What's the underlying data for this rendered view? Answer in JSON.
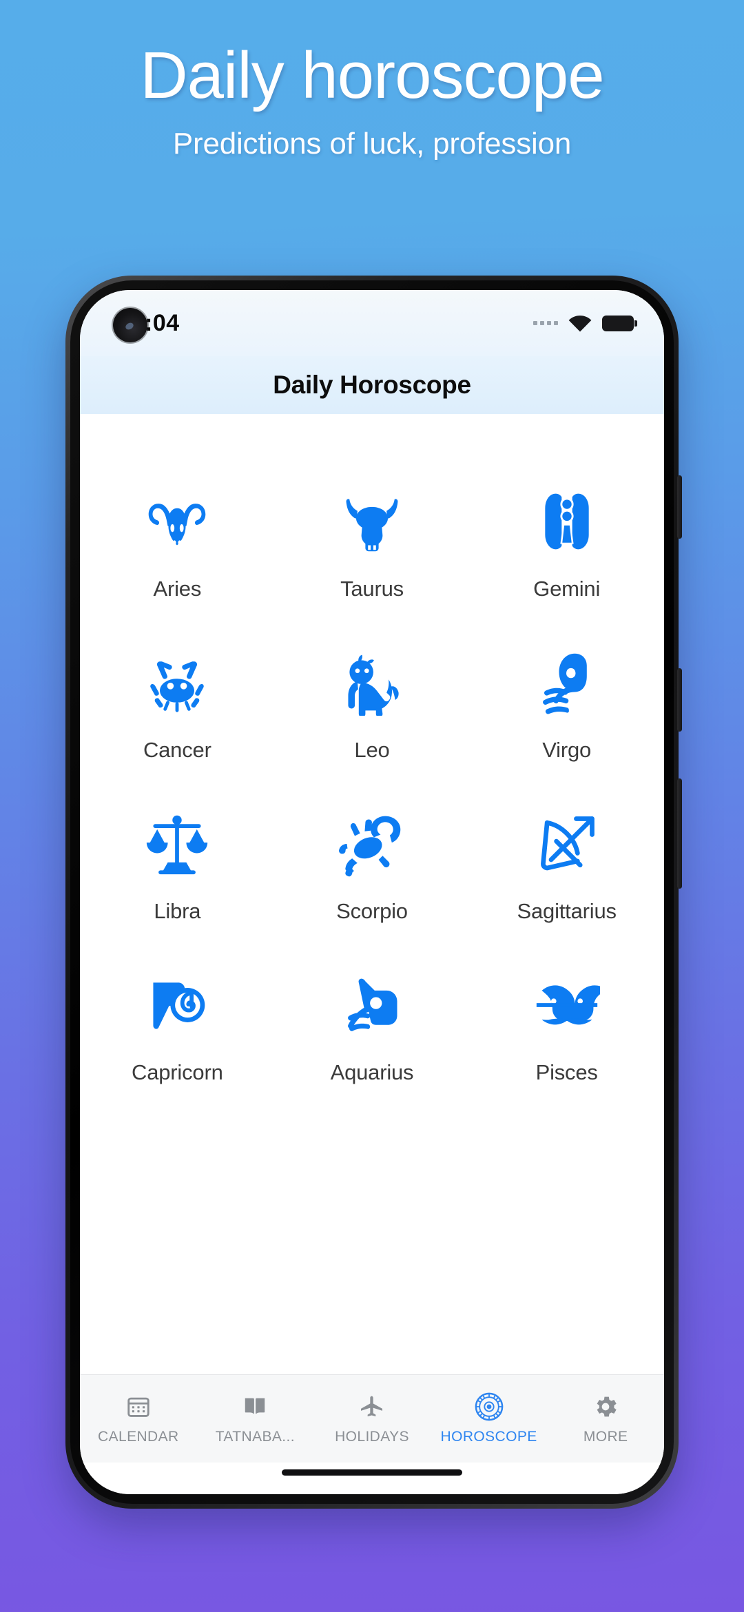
{
  "promo": {
    "title": "Daily horoscope",
    "subtitle": "Predictions of luck, profession",
    "bg_top_color": "#56adea",
    "bg_bottom_color": "#7857e2"
  },
  "phone": {
    "status_bar": {
      "clock": ":04",
      "signal_icon": "signal-dots-icon",
      "wifi_icon": "wifi-icon",
      "battery_icon": "battery-full-icon"
    },
    "app_bar": {
      "title": "Daily Horoscope"
    },
    "accent_color": "#0d7cf2",
    "inactive_color": "#8b8f94",
    "active_tab_color": "#2e85f0",
    "zodiac": [
      {
        "label": "Aries",
        "icon": "aries-ram-icon"
      },
      {
        "label": "Taurus",
        "icon": "taurus-bull-icon"
      },
      {
        "label": "Gemini",
        "icon": "gemini-twins-icon"
      },
      {
        "label": "Cancer",
        "icon": "cancer-crab-icon"
      },
      {
        "label": "Leo",
        "icon": "leo-lion-icon"
      },
      {
        "label": "Virgo",
        "icon": "virgo-maiden-icon"
      },
      {
        "label": "Libra",
        "icon": "libra-scales-icon"
      },
      {
        "label": "Scorpio",
        "icon": "scorpio-scorpion-icon"
      },
      {
        "label": "Sagittarius",
        "icon": "sagittarius-bow-icon"
      },
      {
        "label": "Capricorn",
        "icon": "capricorn-goat-icon"
      },
      {
        "label": "Aquarius",
        "icon": "aquarius-waterbearer-icon"
      },
      {
        "label": "Pisces",
        "icon": "pisces-fish-icon"
      }
    ],
    "bottom_nav": [
      {
        "label": "CALENDAR",
        "icon": "calendar-icon",
        "active": false
      },
      {
        "label": "TATNABA...",
        "icon": "book-icon",
        "active": false
      },
      {
        "label": "HOLIDAYS",
        "icon": "airplane-icon",
        "active": false
      },
      {
        "label": "HOROSCOPE",
        "icon": "zodiac-wheel-icon",
        "active": true
      },
      {
        "label": "MORE",
        "icon": "gear-icon",
        "active": false
      }
    ]
  }
}
